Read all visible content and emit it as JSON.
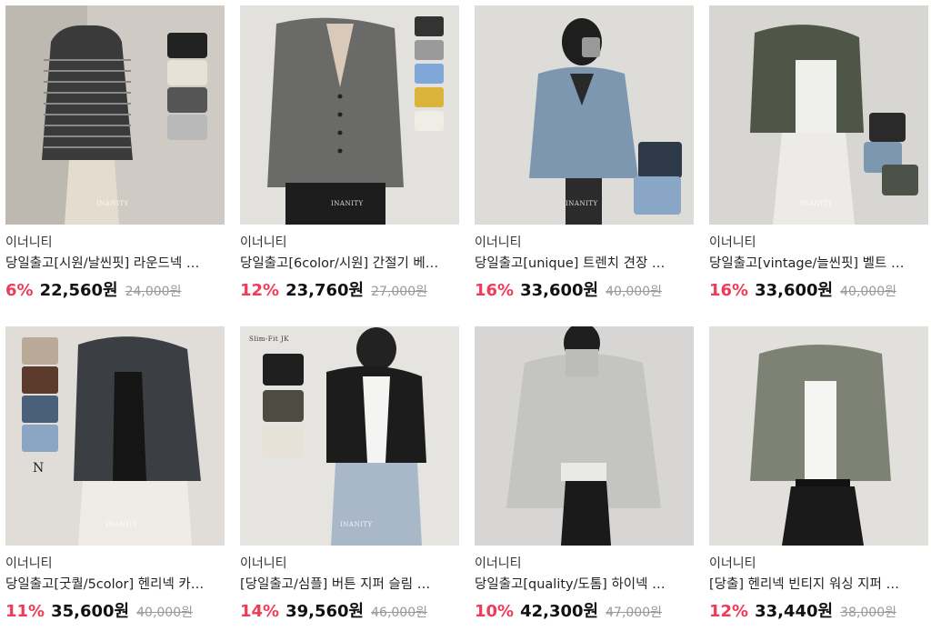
{
  "products": [
    {
      "brand": "이너니티",
      "title": "당일출고[시원/날씬핏] 라운드넥 …",
      "discount": "6%",
      "price": "22,560원",
      "original": "24,000원",
      "image_label": "INANITY"
    },
    {
      "brand": "이너니티",
      "title": "당일출고[6color/시원] 간절기 베…",
      "discount": "12%",
      "price": "23,760원",
      "original": "27,000원",
      "image_label": "INANITY"
    },
    {
      "brand": "이너니티",
      "title": "당일출고[unique] 트렌치 견장 …",
      "discount": "16%",
      "price": "33,600원",
      "original": "40,000원",
      "image_label": "INANITY"
    },
    {
      "brand": "이너니티",
      "title": "당일출고[vintage/늘씬핏] 벨트 …",
      "discount": "16%",
      "price": "33,600원",
      "original": "40,000원",
      "image_label": "INANITY"
    },
    {
      "brand": "이너니티",
      "title": "당일출고[굿퀄/5color] 헨리넥 카…",
      "discount": "11%",
      "price": "35,600원",
      "original": "40,000원",
      "image_label": "INANITY"
    },
    {
      "brand": "이너니티",
      "title": "[당일출고/심플] 버튼 지퍼 슬림 …",
      "discount": "14%",
      "price": "39,560원",
      "original": "46,000원",
      "image_label": "INANITY",
      "image_caption": "Slim-Fit JK"
    },
    {
      "brand": "이너니티",
      "title": "당일출고[quality/도톰] 하이넥 …",
      "discount": "10%",
      "price": "42,300원",
      "original": "47,000원",
      "image_label": ""
    },
    {
      "brand": "이너니티",
      "title": "[당출] 헨리넥 빈티지 워싱 지퍼 …",
      "discount": "12%",
      "price": "33,440원",
      "original": "38,000원",
      "image_label": ""
    }
  ],
  "colors": {
    "discount": "#f03b58",
    "price": "#111111",
    "original_price": "#999999"
  }
}
